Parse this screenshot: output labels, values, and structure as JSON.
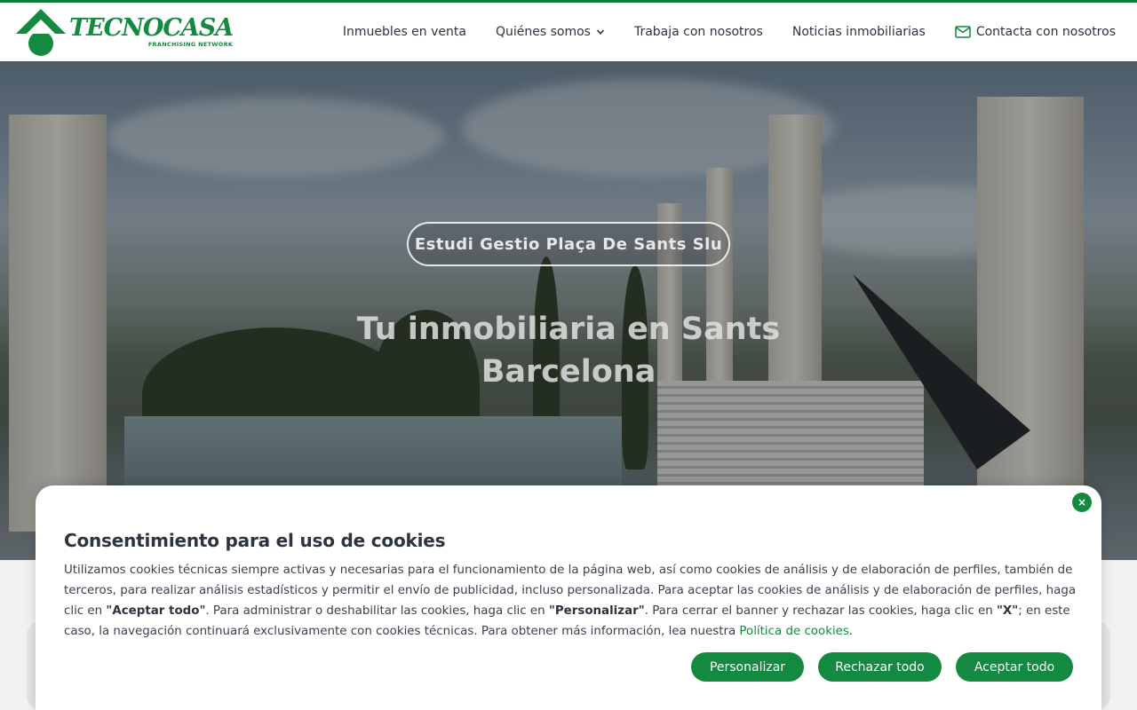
{
  "brand": {
    "name": "TECNOCASA",
    "tagline": "FRANCHISING NETWORK",
    "accent": "#138a3f"
  },
  "nav": {
    "items": [
      {
        "label": "Inmuebles en venta"
      },
      {
        "label": "Quiénes somos",
        "icon": "chevron-down-icon"
      },
      {
        "label": "Trabaja con nosotros"
      },
      {
        "label": "Noticias inmobiliarias"
      }
    ],
    "contact": {
      "label": "Contacta con nosotros",
      "icon": "mail-icon"
    }
  },
  "hero": {
    "agency": "Estudi Gestio Plaça De Sants Slu",
    "title_line1": "Tu inmobiliaria en Sants",
    "title_line2": "Barcelona"
  },
  "cookie": {
    "close": "×",
    "title": "Consentimiento para el uso de cookies",
    "text_part1": "Utilizamos cookies técnicas siempre activas y necesarias para el funcionamiento de la página web, así como cookies de análisis y de elaboración de perfiles, también de terceros, para realizar análisis estadísticos y permitir el envío de publicidad, incluso personalizada. Para aceptar las cookies de análisis y de elaboración de perfiles, haga clic en ",
    "accept_quote": "\"Aceptar todo\"",
    "text_part2": ". Para administrar o deshabilitar las cookies, haga clic en ",
    "customize_quote": "\"Personalizar\"",
    "text_part3": ". Para cerrar el banner y rechazar las cookies, haga clic en ",
    "x_quote": "\"X\"",
    "text_part4": "; en este caso, la navegación continuará exclusivamente con cookies técnicas. Para obtener más información, lea nuestra ",
    "policy_link": "Política de cookies",
    "text_end": ".",
    "buttons": {
      "customize": "Personalizar",
      "reject": "Rechazar todo",
      "accept": "Aceptar todo"
    }
  }
}
